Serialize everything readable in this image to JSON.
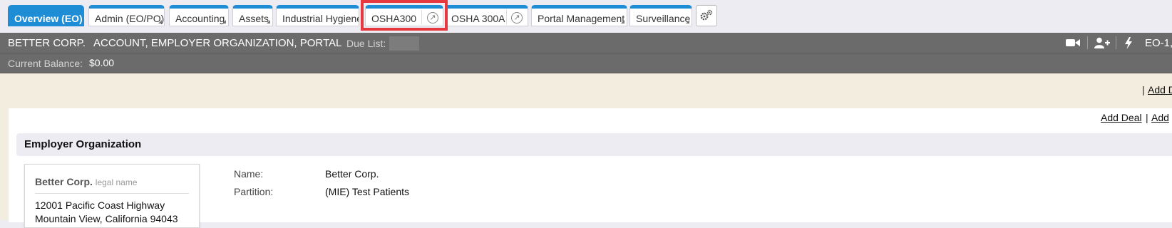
{
  "tabs": [
    {
      "label": "Overview (EO)"
    },
    {
      "label": "Admin (EO/PO)"
    },
    {
      "label": "Accounting"
    },
    {
      "label": "Assets"
    },
    {
      "label": "Industrial Hygiene"
    },
    {
      "label": "OSHA300"
    },
    {
      "label": "OSHA 300A"
    },
    {
      "label": "Portal Management"
    },
    {
      "label": "Surveillance"
    }
  ],
  "header": {
    "org_name": "BETTER CORP.",
    "context": "ACCOUNT, EMPLOYER ORGANIZATION, PORTAL",
    "due_list_label": "Due List:",
    "record_id": "EO-1,",
    "balance_label": "Current Balance:",
    "balance_value": "$0.00"
  },
  "links": {
    "top_right": "Add D",
    "top_right_sep": "|",
    "add_deal": "Add Deal",
    "sep": "|",
    "add_more": "Add"
  },
  "section": {
    "title": "Employer Organization"
  },
  "card": {
    "name": "Better Corp.",
    "legal_tag": "legal name",
    "address_line1": "12001 Pacific Coast Highway",
    "address_line2": "Mountain View, California 94043"
  },
  "details": [
    {
      "label": "Name:",
      "value": "Better Corp."
    },
    {
      "label": "Partition:",
      "value": "(MIE) Test Patients"
    }
  ],
  "colors": {
    "accent": "#1f8dd6",
    "header_bg": "#6b6b6b",
    "highlight": "#e5393f",
    "content_bg": "#f3ede0"
  }
}
